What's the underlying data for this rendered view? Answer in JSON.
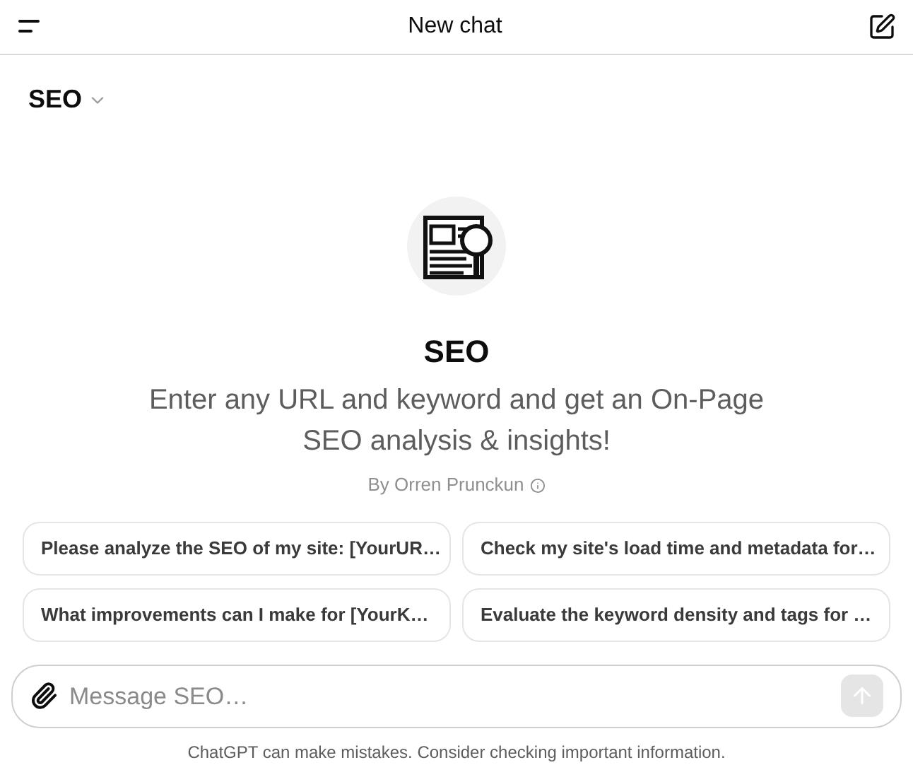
{
  "header": {
    "title": "New chat"
  },
  "model_selector": {
    "label": "SEO"
  },
  "gpt": {
    "name": "SEO",
    "description": "Enter any URL and keyword and get an On-Page SEO analysis & insights!",
    "author": "By Orren Prunckun"
  },
  "suggestions": [
    "Please analyze the SEO of my site: [YourUR…",
    "Check my site's load time and metadata for…",
    "What improvements can I make for [YourK…",
    "Evaluate the keyword density and tags for …"
  ],
  "composer": {
    "placeholder": "Message SEO…",
    "send_disabled": true
  },
  "footer": "ChatGPT can make mistakes. Consider checking important information."
}
